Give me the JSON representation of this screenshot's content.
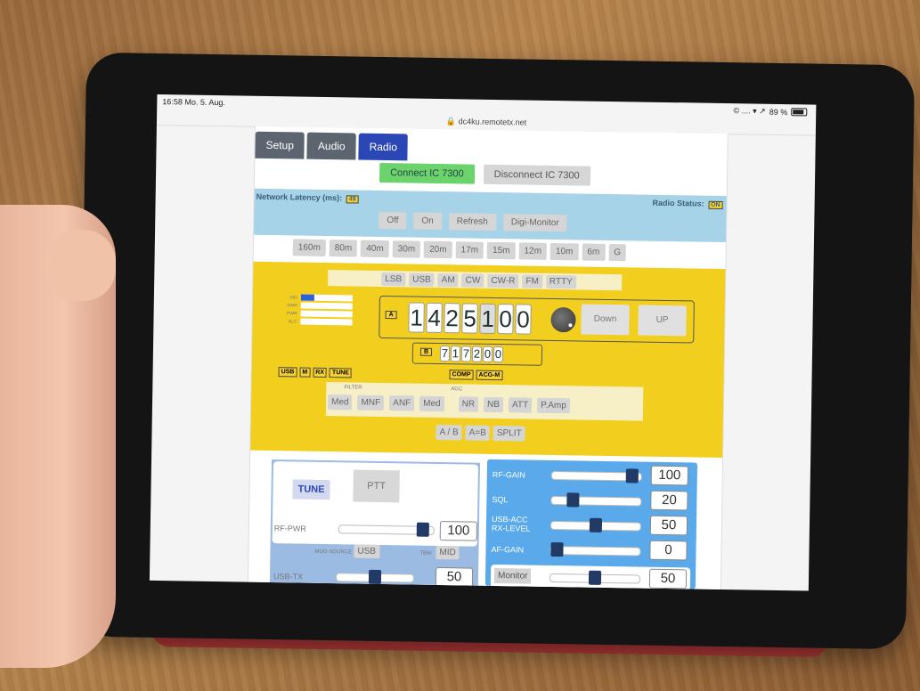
{
  "status_bar": {
    "time": "16:58  Mo. 5. Aug.",
    "signal": "© .... ▾ ↗",
    "battery": "89 %"
  },
  "url": "🔒 dc4ku.remotetx.net",
  "tabs": [
    {
      "label": "Setup"
    },
    {
      "label": "Audio"
    },
    {
      "label": "Radio",
      "active": true
    }
  ],
  "connect": {
    "connect_label": "Connect IC 7300",
    "disconnect_label": "Disconnect IC 7300"
  },
  "network": {
    "latency_label": "Network Latency (ms):",
    "latency_value": "49",
    "radio_status_label": "Radio Status:",
    "radio_status_value": "ON",
    "buttons": [
      "Off",
      "On",
      "Refresh",
      "Digi-Monitor"
    ]
  },
  "bands": [
    "160m",
    "80m",
    "40m",
    "30m",
    "20m",
    "17m",
    "15m",
    "12m",
    "10m",
    "6m",
    "G"
  ],
  "modes": [
    "LSB",
    "USB",
    "AM",
    "CW",
    "CW-R",
    "FM",
    "RTTY"
  ],
  "meters": [
    {
      "label": "SIG",
      "level": 0.25
    },
    {
      "label": "SWR",
      "level": 0
    },
    {
      "label": "PWR",
      "level": 0
    },
    {
      "label": "ALC",
      "level": 0
    }
  ],
  "vfo_a": {
    "tag": "A",
    "digits": [
      "1",
      "4",
      "2",
      "5",
      "1",
      "0",
      "0"
    ],
    "down_label": "Down",
    "up_label": "UP"
  },
  "vfo_b": {
    "tag": "B",
    "digits": [
      "7",
      "1",
      "7",
      "2",
      "0",
      "0"
    ]
  },
  "flags_left": [
    "USB",
    "M",
    "RX",
    "TUNE"
  ],
  "flags_right": [
    "COMP",
    "ACG-M"
  ],
  "filter": {
    "filter_label": "FILTER",
    "agc_label": "AGC",
    "buttons": [
      "Med",
      "MNF",
      "ANF",
      "Med",
      "NR",
      "NB",
      "ATT",
      "P.Amp"
    ]
  },
  "vfo_ops": [
    "A / B",
    "A=B",
    "SPLIT"
  ],
  "tx": {
    "tune_label": "TUNE",
    "ptt_label": "PTT",
    "rf_pwr_label": "RF-PWR",
    "rf_pwr_value": "100",
    "rf_pwr_level": 0.95,
    "mod_source_label": "MOD-SOURCE",
    "mod_source_value": "USB",
    "tbw_label": "TBW",
    "tbw_value": "MID",
    "usb_tx_label": "USB-TX",
    "usb_tx_value": "50",
    "usb_tx_level": 0.5
  },
  "rx": {
    "rf_gain_label": "RF-GAIN",
    "rf_gain_value": "100",
    "rf_gain_level": 0.96,
    "sql_label": "SQL",
    "sql_value": "20",
    "sql_level": 0.2,
    "usb_acc_label_1": "USB-ACC",
    "usb_acc_label_2": "RX-LEVEL",
    "usb_acc_value": "50",
    "usb_acc_level": 0.5,
    "af_gain_label": "AF-GAIN",
    "af_gain_value": "0",
    "af_gain_level": 0,
    "monitor_label": "Monitor",
    "monitor_value": "50",
    "monitor_level": 0.5
  }
}
